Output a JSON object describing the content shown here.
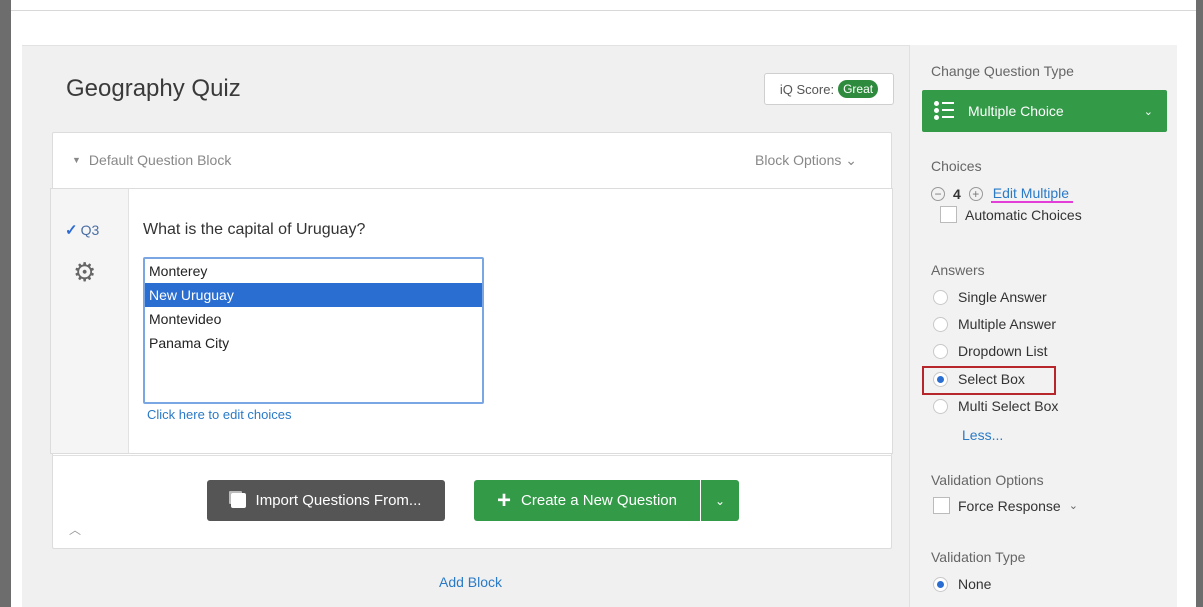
{
  "survey": {
    "title": "Geography Quiz",
    "iq_score_label": "iQ Score:",
    "iq_score_value": "Great"
  },
  "block": {
    "name": "Default Question Block",
    "options_label": "Block Options"
  },
  "question": {
    "number": "Q3",
    "text": "What is the capital of Uruguay?",
    "choices": [
      "Monterey",
      "New Uruguay",
      "Montevideo",
      "Panama City"
    ],
    "selected_choice": "New Uruguay",
    "edit_choices_label": "Click here to edit choices"
  },
  "footer": {
    "import_label": "Import Questions From...",
    "create_label": "Create a New Question",
    "add_block_label": "Add Block"
  },
  "sidebar": {
    "change_type_heading": "Change Question Type",
    "question_type": "Multiple Choice",
    "choices_heading": "Choices",
    "choice_count": "4",
    "edit_multiple_label": "Edit Multiple",
    "automatic_choices_label": "Automatic Choices",
    "answers_heading": "Answers",
    "answers": [
      {
        "label": "Single Answer",
        "selected": false
      },
      {
        "label": "Multiple Answer",
        "selected": false
      },
      {
        "label": "Dropdown List",
        "selected": false
      },
      {
        "label": "Select Box",
        "selected": true
      },
      {
        "label": "Multi Select Box",
        "selected": false
      }
    ],
    "less_label": "Less...",
    "validation_options_heading": "Validation Options",
    "force_response_label": "Force Response",
    "validation_type_heading": "Validation Type",
    "validation_none_label": "None"
  },
  "colors": {
    "primary_green": "#339a48",
    "selection_blue": "#2b6ed1",
    "link_blue": "#2a7ac6",
    "highlight_red": "#b7262b",
    "underline_magenta": "#e43ed8"
  }
}
